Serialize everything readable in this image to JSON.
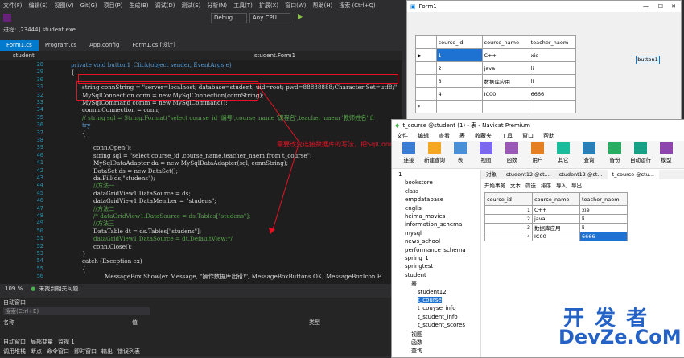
{
  "vs": {
    "menu": [
      "文件(F)",
      "编辑(E)",
      "视图(V)",
      "Git(G)",
      "项目(P)",
      "生成(B)",
      "调试(D)",
      "测试(S)",
      "分析(N)",
      "工具(T)",
      "扩展(X)",
      "窗口(W)",
      "帮助(H)",
      "搜索 (Ctrl+Q)"
    ],
    "toolbar": {
      "config": "Debug",
      "platform": "Any CPU",
      "start": "启动"
    },
    "process": "进程: [23444] student.exe",
    "tabs": [
      "Form1.cs",
      "Program.cs",
      "App.config",
      "Form1.cs [设计]"
    ],
    "nav_left": "student",
    "nav_right": "student.Form1",
    "lines": [
      {
        "n": "28",
        "t": "private void button1_Click(object sender, EventArgs e)"
      },
      {
        "n": "29",
        "t": "{"
      },
      {
        "n": "30",
        "t": ""
      },
      {
        "n": "31",
        "t": "string connString = \"server=localhost; database=student; uid=root; pwd=88888888;Character Set=utf8;\""
      },
      {
        "n": "32",
        "t": "MySqlConnection conn = new MySqlConnection(connString);"
      },
      {
        "n": "33",
        "t": "MySqlCommand comm = new MySqlCommand();"
      },
      {
        "n": "34",
        "t": "comm.Connection = conn;"
      },
      {
        "n": "35",
        "t": "// string sql = String.Format(\"select course_id '编号',course_name '课程名',teacher_naem '教师姓名' fr"
      },
      {
        "n": "36",
        "t": "try"
      },
      {
        "n": "37",
        "t": "{"
      },
      {
        "n": "38",
        "t": ""
      },
      {
        "n": "39",
        "t": "conn.Open();"
      },
      {
        "n": "40",
        "t": "string sql = \"select course_id ,course_name,teacher_naem from t_course\";"
      },
      {
        "n": "41",
        "t": "MySqlDataAdapter da = new MySqlDataAdapter(sql, connString);"
      },
      {
        "n": "42",
        "t": "DataSet ds = new DataSet();"
      },
      {
        "n": "43",
        "t": "da.Fill(ds,\"studens\");"
      },
      {
        "n": "44",
        "t": "//方法一"
      },
      {
        "n": "45",
        "t": "dataGridView1.DataSource = ds;"
      },
      {
        "n": "46",
        "t": "dataGridView1.DataMember = \"studens\";"
      },
      {
        "n": "47",
        "t": "//方法二"
      },
      {
        "n": "48",
        "t": "/* dataGridView1.DataSource = ds.Tables[\"studens\"];"
      },
      {
        "n": "49",
        "t": "//方法三"
      },
      {
        "n": "50",
        "t": "DataTable dt = ds.Tables[\"studens\"];"
      },
      {
        "n": "51",
        "t": "dataGridView1.DataSource = dt.DefaultView;*/"
      },
      {
        "n": "52",
        "t": "conn.Close();"
      },
      {
        "n": "53",
        "t": "}"
      },
      {
        "n": "54",
        "t": "catch (Exception ex)"
      },
      {
        "n": "55",
        "t": "{"
      },
      {
        "n": "56",
        "t": "MessageBox.Show(ex.Message, \"操作数据库出错!\", MessageBoxButtons.OK, MessageBoxIcon.E"
      }
    ],
    "annotation": "需要改变连接数据库的写法，把SqlConnection和SqlCammand 添加My并导入命名空间",
    "status": {
      "zoom": "109 %",
      "issues": "未找到相关问题"
    },
    "output": {
      "title": "自动窗口",
      "search": "搜索(Ctrl+E)",
      "cols": [
        "名称",
        "值",
        "类型"
      ],
      "bottom_tabs": [
        "自动窗口",
        "局部变量",
        "监视 1"
      ],
      "bottom2": [
        "调用堆栈",
        "断点",
        "命令窗口",
        "即时窗口",
        "输出",
        "错误列表"
      ]
    }
  },
  "form1": {
    "title": "Form1",
    "columns": [
      "course_id",
      "course_name",
      "teacher_naem"
    ],
    "rows": [
      [
        "1",
        "C++",
        "xie"
      ],
      [
        "2",
        "java",
        "li"
      ],
      [
        "3",
        "数据库应用",
        "li"
      ],
      [
        "4",
        "IC00",
        "6666"
      ]
    ],
    "button": "button1"
  },
  "navicat": {
    "title": "t_course @student (1) - 表 - Navicat Premium",
    "menu": [
      "文件",
      "编辑",
      "查看",
      "表",
      "收藏夹",
      "工具",
      "窗口",
      "帮助"
    ],
    "toolbar": [
      "连接",
      "新建查询",
      "表",
      "视图",
      "函数",
      "用户",
      "其它",
      "查询",
      "备份",
      "自动运行",
      "模型"
    ],
    "tabs": [
      "对象",
      "student12 @st...",
      "student12 @st...",
      "t_course @stu..."
    ],
    "subtool": [
      "开始事务",
      "文本",
      "筛选",
      "排序",
      "导入",
      "导出"
    ],
    "tree": [
      {
        "label": "1",
        "level": 0
      },
      {
        "label": "bookstore",
        "level": 1
      },
      {
        "label": "class",
        "level": 1
      },
      {
        "label": "empdatabase",
        "level": 1
      },
      {
        "label": "englis",
        "level": 1
      },
      {
        "label": "heima_movies",
        "level": 1
      },
      {
        "label": "information_schema",
        "level": 1
      },
      {
        "label": "mysql",
        "level": 1
      },
      {
        "label": "news_school",
        "level": 1
      },
      {
        "label": "performance_schema",
        "level": 1
      },
      {
        "label": "spring_1",
        "level": 1
      },
      {
        "label": "springtest",
        "level": 1
      },
      {
        "label": "student",
        "level": 1
      },
      {
        "label": "表",
        "level": 2
      },
      {
        "label": "student12",
        "level": 3
      },
      {
        "label": "t_course",
        "level": 3
      },
      {
        "label": "t_couyse_info",
        "level": 3
      },
      {
        "label": "t_student_info",
        "level": 3
      },
      {
        "label": "t_student_scores",
        "level": 3
      },
      {
        "label": "视图",
        "level": 2
      },
      {
        "label": "函数",
        "level": 2
      },
      {
        "label": "查询",
        "level": 2
      }
    ],
    "columns": [
      "course_id",
      "course_name",
      "teacher_naem"
    ],
    "rows": [
      [
        "1",
        "C++",
        "xie"
      ],
      [
        "2",
        "java",
        "li"
      ],
      [
        "3",
        "数据库应用",
        "li"
      ],
      [
        "4",
        "IC00",
        "6666"
      ]
    ]
  },
  "watermark": {
    "line1": "开 发 者",
    "line2": "DevZe.CoM"
  },
  "colors": {
    "accent": "#007acc",
    "annotation": "#e81123",
    "watermark": "#2463c5"
  }
}
